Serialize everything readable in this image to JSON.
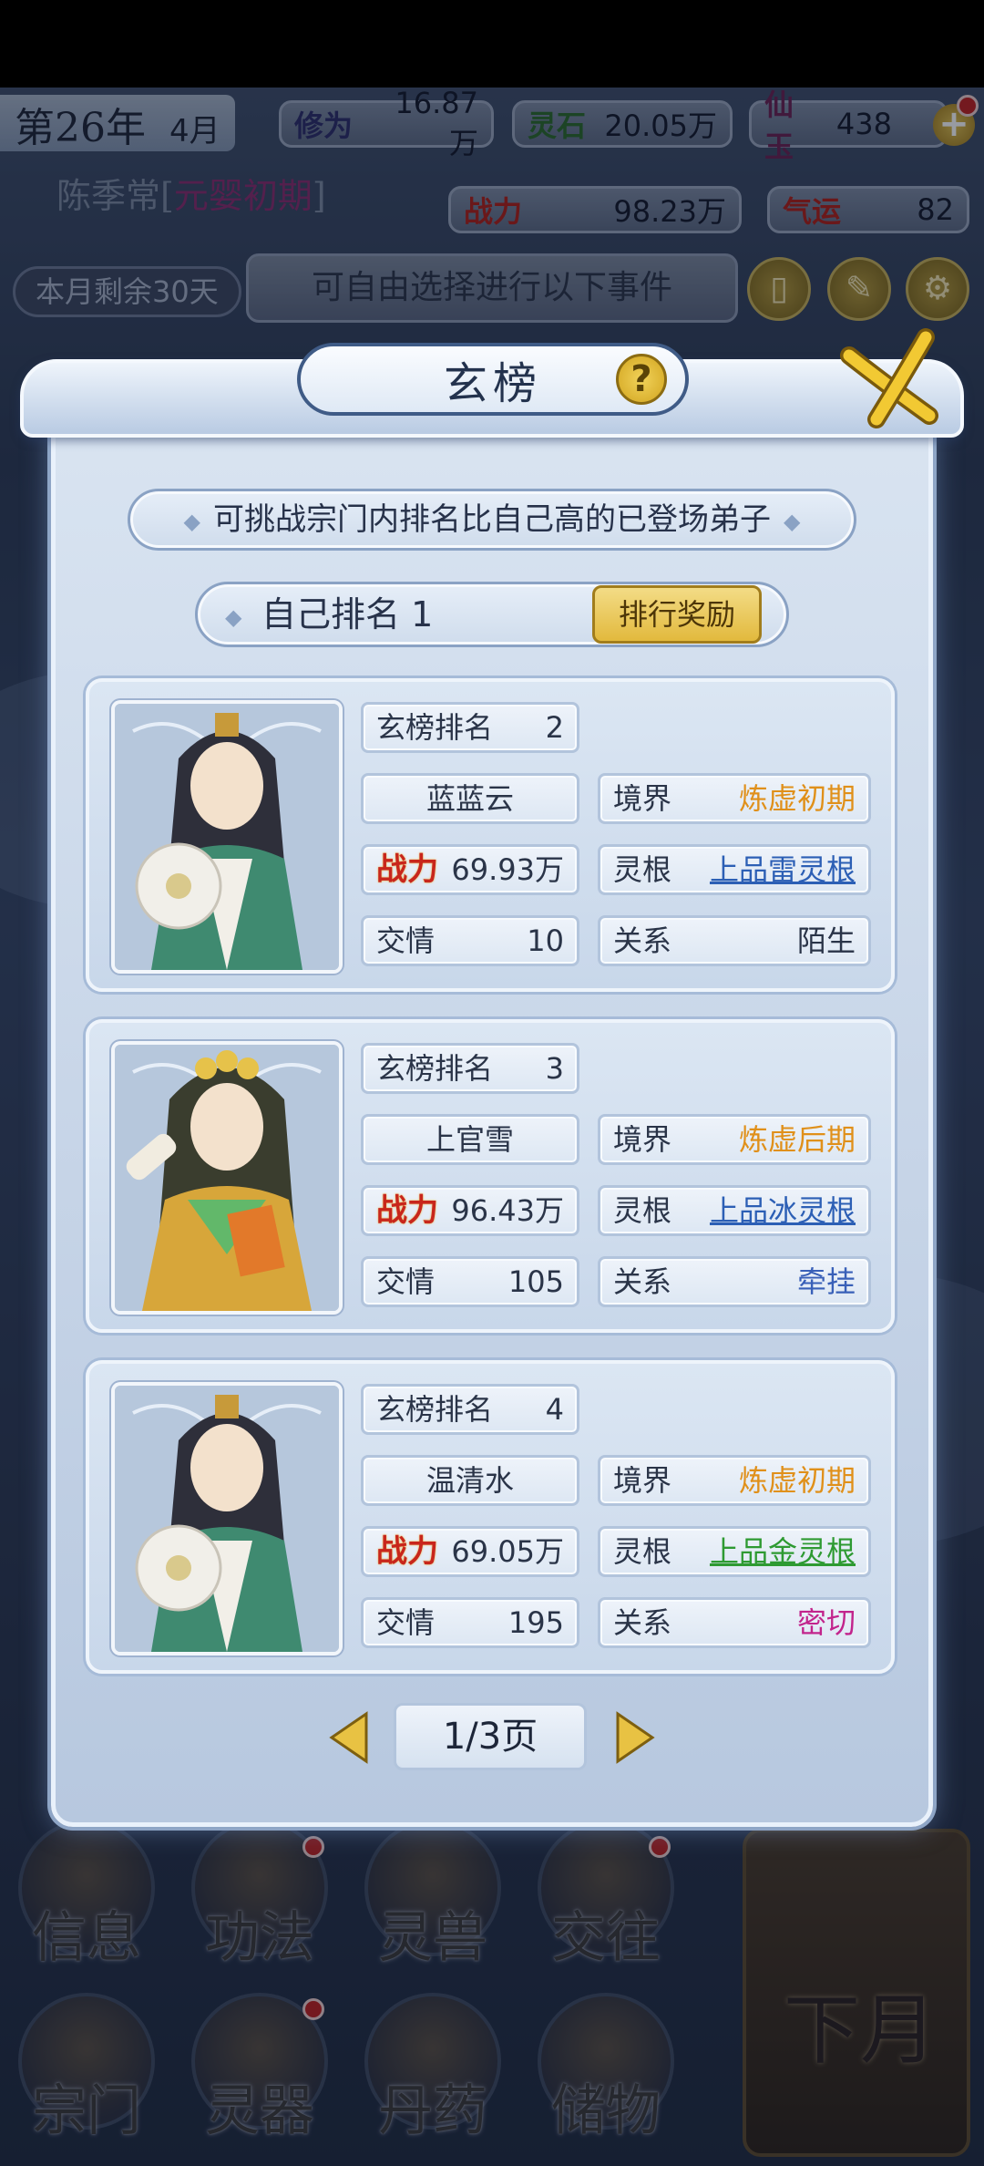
{
  "hud": {
    "year": "第26年",
    "month": "4月",
    "cultivation_label": "修为",
    "cultivation_value": "16.87万",
    "spirit_stone_label": "灵石",
    "spirit_stone_value": "20.05万",
    "jade_label": "仙玉",
    "jade_value": "438",
    "plus_label": "+",
    "power_label": "战力",
    "power_value": "98.23万",
    "luck_label": "气运",
    "luck_value": "82",
    "player_name": "陈季常",
    "player_realm": "元婴初期",
    "month_remaining": "本月剩余30天",
    "free_choose": "可自由选择进行以下事件"
  },
  "modal": {
    "title": "玄榜",
    "help_symbol": "?",
    "hint": "可挑战宗门内排名比自己高的已登场弟子",
    "self_rank_label": "自己排名 1",
    "reward_button": "排行奖励",
    "page_label": "1/3页"
  },
  "labels": {
    "rank": "玄榜排名",
    "realm": "境界",
    "power": "战力",
    "root": "灵根",
    "affinity": "交情",
    "relation": "关系"
  },
  "cards": [
    {
      "rank": "2",
      "name": "蓝蓝云",
      "realm": "炼虚初期",
      "power": "69.93万",
      "root": "上品雷灵根",
      "affinity": "10",
      "relation": "陌生"
    },
    {
      "rank": "3",
      "name": "上官雪",
      "realm": "炼虚后期",
      "power": "96.43万",
      "root": "上品冰灵根",
      "affinity": "105",
      "relation": "牵挂"
    },
    {
      "rank": "4",
      "name": "温清水",
      "realm": "炼虚初期",
      "power": "69.05万",
      "root": "上品金灵根",
      "affinity": "195",
      "relation": "密切"
    }
  ],
  "nav": {
    "info": "信息",
    "technique": "功法",
    "beast": "灵兽",
    "social": "交往",
    "sect": "宗门",
    "artifact": "灵器",
    "pill": "丹药",
    "storage": "储物",
    "next_month": "下月"
  },
  "colors": {
    "accent_gold": "#e2b93d",
    "power_red": "#c8261c",
    "realm_orange": "#e0901a",
    "link_blue": "#2c5fb5",
    "link_green": "#2e9a32",
    "relation_pink": "#c2248c"
  }
}
